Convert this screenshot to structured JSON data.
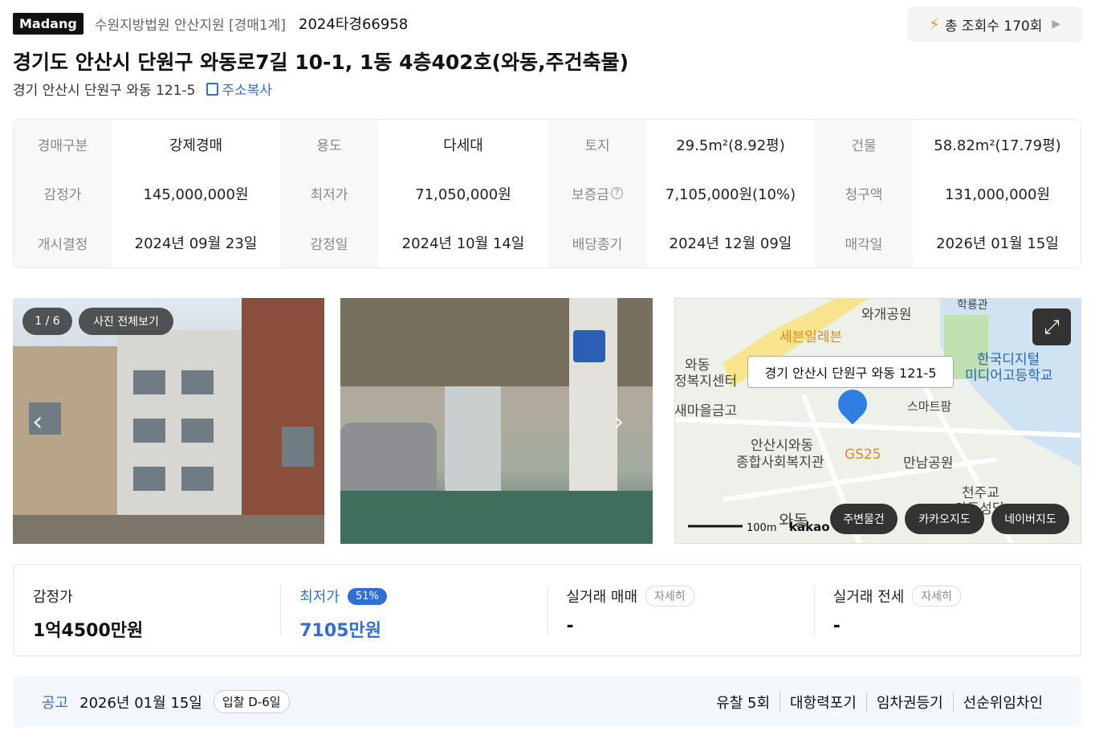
{
  "header": {
    "logo": "Madang",
    "court": "수원지방법원 안산지원 [경매1계]",
    "case_no": "2024타경66958",
    "views": "총 조회수 170회"
  },
  "title": "경기도 안산시 단원구 와동로7길 10-1, 1동 4층402호(와동,주건축물)",
  "sub_address": "경기 안산시 단원구 와동 121-5",
  "copy_label": "주소복사",
  "info": [
    {
      "k": "경매구분",
      "v": "강제경매"
    },
    {
      "k": "용도",
      "v": "다세대"
    },
    {
      "k": "토지",
      "v": "29.5m²(8.92평)"
    },
    {
      "k": "건물",
      "v": "58.82m²(17.79평)"
    },
    {
      "k": "감정가",
      "v": "145,000,000원"
    },
    {
      "k": "최저가",
      "v": "71,050,000원"
    },
    {
      "k": "보증금",
      "v": "7,105,000원(10%)"
    },
    {
      "k": "청구액",
      "v": "131,000,000원"
    },
    {
      "k": "개시결정",
      "v": "2024년 09월 23일"
    },
    {
      "k": "감정일",
      "v": "2024년 10월 14일"
    },
    {
      "k": "배당종기",
      "v": "2024년 12월 09일"
    },
    {
      "k": "매각일",
      "v": "2026년 01월 15일"
    }
  ],
  "gallery": {
    "counter": "1 / 6",
    "view_all": "사진 전체보기"
  },
  "map": {
    "address_popup": "경기 안산시 단원구 와동 121-5",
    "labels": [
      "와개공원",
      "세븐일레븐",
      "와동",
      "정복지센터",
      "새마을금고",
      "한국디지털",
      "미디어고등학교",
      "스마트팜",
      "안산시와동",
      "종합사회복지관",
      "GS25",
      "만남공원",
      "천주교",
      "와동성당",
      "학룡관",
      "와동"
    ],
    "scale": "100m",
    "brand": "kakao",
    "btn_nearby": "주변물건",
    "btn_kakao": "카카오지도",
    "btn_naver": "네이버지도"
  },
  "prices": {
    "appraisal_label": "감정가",
    "appraisal": "1억4500만원",
    "min_label": "최저가",
    "min_pct": "51%",
    "min": "7105만원",
    "trade_label": "실거래 매매",
    "trade_detail": "자세히",
    "trade_val": "-",
    "jeonse_label": "실거래 전세",
    "jeonse_detail": "자세히",
    "jeonse_val": "-"
  },
  "notice": {
    "label": "공고",
    "date": "2026년 01월 15일",
    "tag": "입찰 D-6일",
    "tags": [
      "유찰 5회",
      "대항력포기",
      "임차권등기",
      "선순위임차인"
    ]
  }
}
